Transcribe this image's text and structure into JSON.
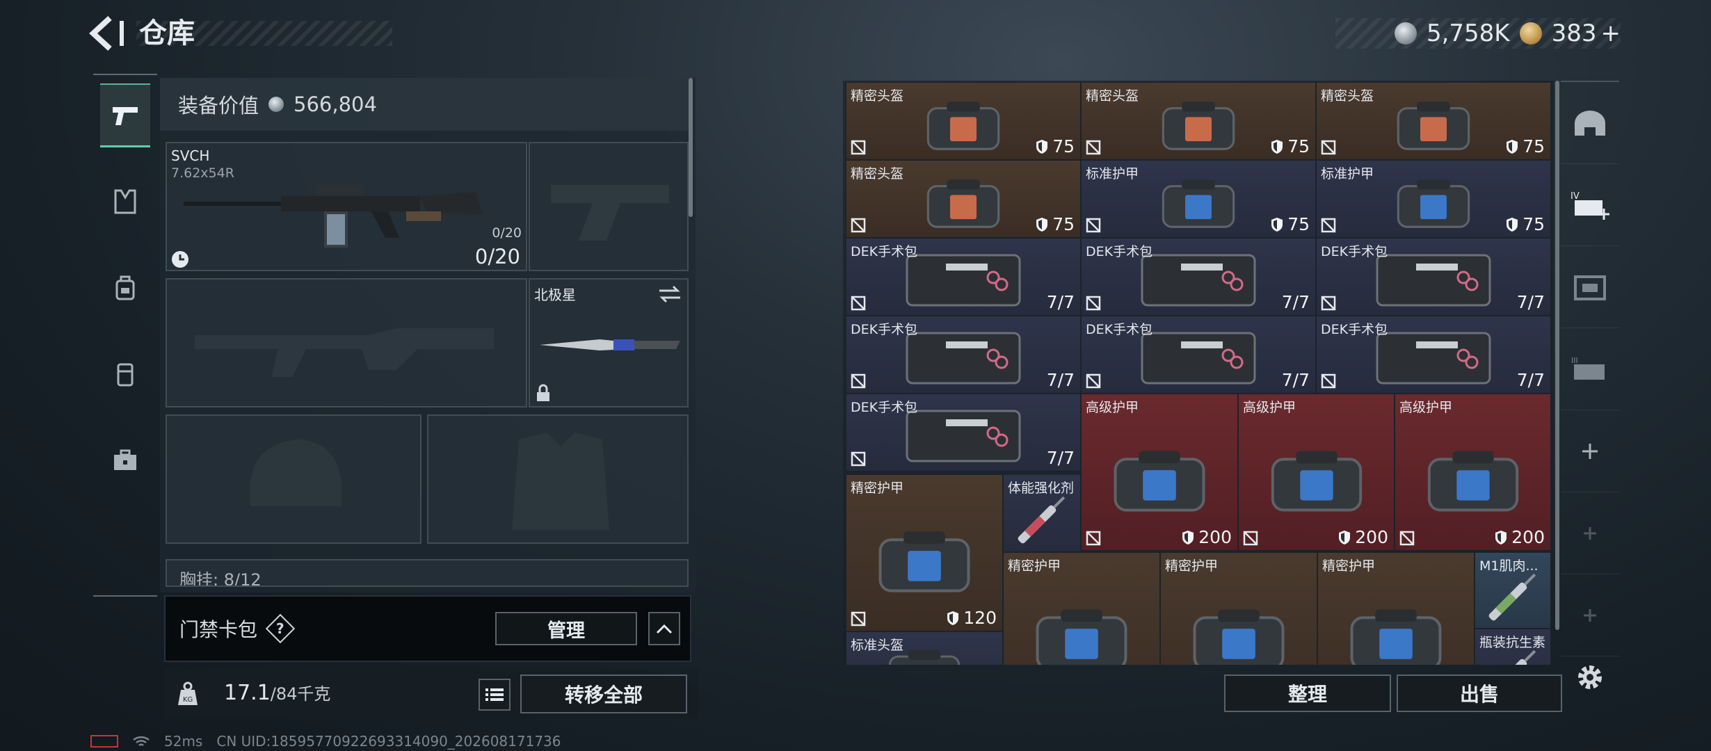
{
  "header": {
    "title": "仓库"
  },
  "currency": {
    "silver": "5,758K",
    "gold": "383",
    "gold_suffix": "+"
  },
  "loadout": {
    "equipment_value_label": "装备价值",
    "equipment_value": "566,804",
    "primary": {
      "name": "SVCH",
      "caliber": "7.62x54R",
      "mag_small": "0/20",
      "ammo": "0/20"
    },
    "melee": {
      "name": "北极星"
    },
    "chest_rig_partial": "胸挂: 8/12"
  },
  "keycard": {
    "label": "门禁卡包",
    "manage_label": "管理"
  },
  "weight": {
    "current": "17.1",
    "max": "/84千克",
    "transfer_label": "转移全部"
  },
  "stash_items": [
    {
      "name": "精密头盔",
      "value": "75",
      "color": "brown"
    },
    {
      "name": "精密头盔",
      "value": "75",
      "color": "brown"
    },
    {
      "name": "精密头盔",
      "value": "75",
      "color": "brown"
    },
    {
      "name": "精密头盔",
      "value": "75",
      "color": "brown"
    },
    {
      "name": "标准护甲",
      "value": "75",
      "color": "navy"
    },
    {
      "name": "标准护甲",
      "value": "75",
      "color": "navy"
    },
    {
      "name": "DEK手术包",
      "value": "7/7",
      "color": "navy"
    },
    {
      "name": "DEK手术包",
      "value": "7/7",
      "color": "navy"
    },
    {
      "name": "DEK手术包",
      "value": "7/7",
      "color": "navy"
    },
    {
      "name": "DEK手术包",
      "value": "7/7",
      "color": "navy"
    },
    {
      "name": "DEK手术包",
      "value": "7/7",
      "color": "navy"
    },
    {
      "name": "DEK手术包",
      "value": "7/7",
      "color": "navy"
    },
    {
      "name": "DEK手术包",
      "value": "7/7",
      "color": "navy"
    },
    {
      "name": "高级护甲",
      "value": "200",
      "color": "red"
    },
    {
      "name": "高级护甲",
      "value": "200",
      "color": "red"
    },
    {
      "name": "高级护甲",
      "value": "200",
      "color": "red"
    },
    {
      "name": "精密护甲",
      "value": "120",
      "color": "brown"
    },
    {
      "name": "体能强化剂",
      "value": "",
      "color": "navy"
    },
    {
      "name": "精密护甲",
      "value": "",
      "color": "brown"
    },
    {
      "name": "精密护甲",
      "value": "",
      "color": "brown"
    },
    {
      "name": "精密护甲",
      "value": "",
      "color": "brown"
    },
    {
      "name": "M1肌肉...",
      "value": "",
      "color": "teal"
    },
    {
      "name": "标准头盔",
      "value": "",
      "color": "navy"
    },
    {
      "name": "瓶装抗生素",
      "value": "",
      "color": "navy"
    }
  ],
  "stash_actions": {
    "sort_label": "整理",
    "sell_label": "出售"
  },
  "status_bar": {
    "ping": "52ms",
    "uid": "CN UID:18595770922693314090_202608171736"
  },
  "icons": [
    "back-arrow-icon",
    "pistol-icon",
    "vest-icon",
    "backpack-icon",
    "pouch-icon",
    "toolbox-icon",
    "swap-icon",
    "lock-icon",
    "kg-icon",
    "list-icon",
    "chevron-up-icon",
    "helmet-tab-icon",
    "add-case-icon",
    "case-tab-icon",
    "add-icon",
    "gear-icon",
    "no-insure-icon",
    "shield-icon",
    "wifi-icon",
    "battery-icon"
  ],
  "colors": {
    "accent": "#5fd0ae",
    "brown_cell": "#4a3a2e",
    "navy_cell": "#2e344a",
    "red_cell": "#6a2a2e"
  }
}
